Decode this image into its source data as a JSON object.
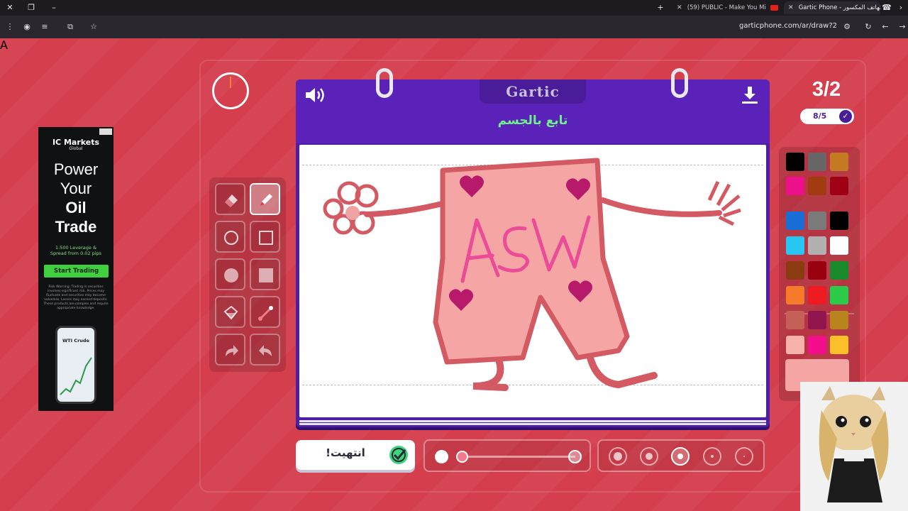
{
  "browser": {
    "tabs": [
      {
        "title": "(59) PUBLIC - Make You Mi",
        "has_youtube_badge": true
      },
      {
        "title": "Gartic Phone - الهاتف المكسور",
        "active": true
      }
    ],
    "url": "garticphone.com/ar/draw?2"
  },
  "ad": {
    "brand": "IC Markets",
    "brand_sub": "Global",
    "headline_lines": [
      "Power",
      "Your",
      "Oil",
      "Trade"
    ],
    "headline_1": "Power",
    "headline_2": "Your",
    "headline_3": "Oil",
    "headline_4": "Trade",
    "leverage": "1:500 Leverage &",
    "spread": "Spread from 0.02 pips",
    "cta": "Start Trading",
    "risk_text": "Risk Warning: Trading in securities involves significant risk. Prices may fluctuate and securities may become valueless. Losses may exceed deposits. These products are complex and require appropriate knowledge.",
    "phone_label": "WTI Crude"
  },
  "game": {
    "logo": "Gartic",
    "prompt": "تابع بالجسم",
    "round": "3/2",
    "players_done": "8/5",
    "timer_remaining_fraction": 0.99,
    "done_label": "انتهيت!",
    "selected_tool": "pencil",
    "tools": [
      "eraser",
      "pencil",
      "ellipse-outline",
      "rectangle-outline",
      "ellipse-filled",
      "rectangle-filled",
      "fill-bucket",
      "line",
      "redo",
      "undo"
    ],
    "brush_size_levels": 3,
    "brush_size_selected": 1,
    "opacity_levels": 5,
    "opacity_selected_index": 2,
    "drawing_text": "ASW",
    "colors_primary": [
      "#000000",
      "#666666",
      "#c47a22",
      "#ec108a",
      "#a03c10",
      "#a00013"
    ],
    "colors_extended": [
      "#1a6fd6",
      "#7a7a7a",
      "#000000",
      "#28c6f2",
      "#b0b0b0",
      "#ffffff",
      "#8a3c10",
      "#990010",
      "#198a2a",
      "#f57a2a",
      "#ee1b22",
      "#2ccb4a",
      "#c46057",
      "#92164e",
      "#b8841d",
      "#f8b1ab",
      "#f40d8d",
      "#fbbf2a"
    ],
    "current_color": "#f6a5a5",
    "accent": "#5a22b8",
    "prompt_color": "#6ff08a"
  }
}
